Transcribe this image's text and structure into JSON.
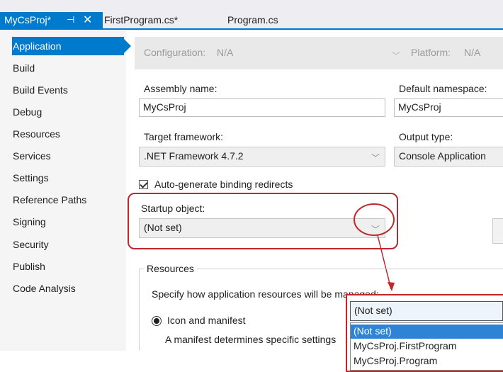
{
  "tabs": [
    {
      "label": "MyCsProj*",
      "active": true
    },
    {
      "label": "FirstProgram.cs*",
      "active": false
    },
    {
      "label": "Program.cs",
      "active": false
    }
  ],
  "tab_icons": {
    "pin": "⊣",
    "close": "✕"
  },
  "nav": {
    "items": [
      "Application",
      "Build",
      "Build Events",
      "Debug",
      "Resources",
      "Services",
      "Settings",
      "Reference Paths",
      "Signing",
      "Security",
      "Publish",
      "Code Analysis"
    ],
    "selected": "Application"
  },
  "config": {
    "configuration_label": "Configuration:",
    "configuration_value": "N/A",
    "platform_label": "Platform:",
    "platform_value": "N/A"
  },
  "form": {
    "assembly_name_label": "Assembly name:",
    "assembly_name_value": "MyCsProj",
    "default_namespace_label": "Default namespace:",
    "default_namespace_value": "MyCsProj",
    "target_framework_label": "Target framework:",
    "target_framework_value": ".NET Framework 4.7.2",
    "output_type_label": "Output type:",
    "output_type_value": "Console Application",
    "binding_redirects_label": "Auto-generate binding redirects",
    "binding_redirects_checked": true,
    "startup_object_label": "Startup object:",
    "startup_object_value": "(Not set)"
  },
  "resources": {
    "group_label": "Resources",
    "description": "Specify how application resources will be managed:",
    "icon_manifest_label": "Icon and manifest",
    "icon_manifest_desc": "A manifest determines specific settings"
  },
  "dropdown": {
    "selected": "(Not set)",
    "options": [
      "(Not set)",
      "MyCsProj.FirstProgram",
      "MyCsProj.Program"
    ],
    "highlighted_index": 0
  },
  "colors": {
    "accent": "#007acc",
    "annotation": "#c0262b"
  }
}
